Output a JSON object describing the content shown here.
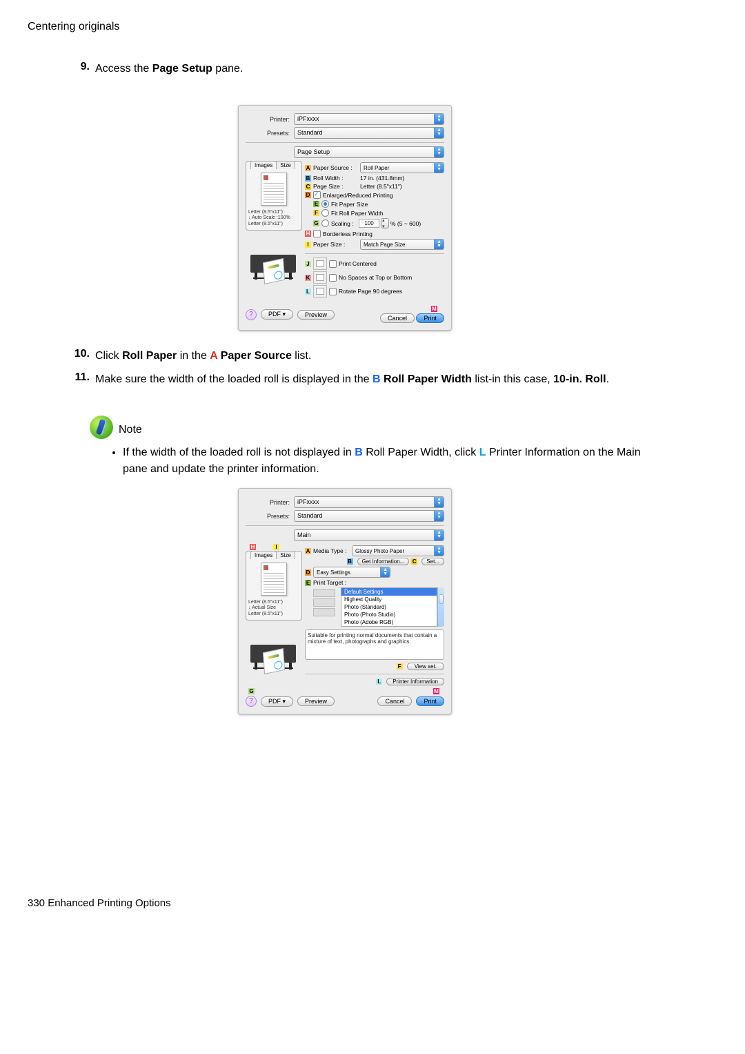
{
  "header": {
    "title": "Centering originals"
  },
  "steps": {
    "s9": {
      "num": "9.",
      "t1": "Access the ",
      "bold1": "Page Setup",
      "t2": " pane."
    },
    "s10": {
      "num": "10.",
      "t1": "Click ",
      "bold1": "Roll Paper",
      "t2": " in the ",
      "la": "A",
      "bold2": " Paper Source",
      "t3": " list."
    },
    "s11": {
      "num": "11.",
      "t1": "Make sure the width of the loaded roll is displayed in the ",
      "lb": "B",
      "bold1": " Roll Paper Width",
      "t2": " list-in this case, ",
      "bold2": "10-in.  Roll",
      "t3": "."
    }
  },
  "note": {
    "label": "Note",
    "line": {
      "t1": "If the width of the loaded roll is not displayed in ",
      "lb": "B",
      "bold1": " Roll Paper Width",
      "t2": ", click ",
      "ll": "L",
      "bold2": " Printer Information",
      "t3": " on the ",
      "bold3": "Main",
      "t4": " pane and update the printer information."
    }
  },
  "dlg1": {
    "printer_label": "Printer:",
    "printer_val": "iPFxxxx",
    "presets_label": "Presets:",
    "presets_val": "Standard",
    "pane_val": "Page Setup",
    "tabs": {
      "images": "Images",
      "size": "Size"
    },
    "prev_line1": "Letter (8.5\"x11\")",
    "prev_line2_arrow": "↓",
    "prev_line2": "Auto Scale :100%",
    "prev_line3": "Letter (8.5\"x11\")",
    "A": {
      "label": "Paper Source :",
      "val": "Roll Paper"
    },
    "B": {
      "label": "Roll Width :",
      "val": "17 in. (431.8mm)"
    },
    "C": {
      "label": "Page Size :",
      "val": "Letter (8.5\"x11\")"
    },
    "D": "Enlarged/Reduced Printing",
    "E": "Fit Paper Size",
    "F": "Fit Roll Paper Width",
    "G": {
      "label": "Scaling :",
      "val": "100",
      "suffix": "% (5 ~ 600)"
    },
    "H": "Borderless Printing",
    "I": {
      "label": "Paper Size :",
      "val": "Match Page Size"
    },
    "J": "Print Centered",
    "K": "No Spaces at Top or Bottom",
    "L": "Rotate Page 90 degrees",
    "help": "?",
    "pdf": "PDF ▾",
    "preview": "Preview",
    "cancel": "Cancel",
    "print": "Print",
    "Mtag": "M"
  },
  "dlg2": {
    "printer_label": "Printer:",
    "printer_val": "iPFxxxx",
    "presets_label": "Presets:",
    "presets_val": "Standard",
    "pane_val": "Main",
    "tabs": {
      "images": "Images",
      "size": "Size"
    },
    "Htag": "H",
    "Itag": "I",
    "prev_line1": "Letter (8.5\"x11\")",
    "prev_line2_arrow": "↓",
    "prev_line2": "Actual Size",
    "prev_line3": "Letter (8.5\"x11\")",
    "A": {
      "label": "Media Type :",
      "val": "Glossy Photo Paper"
    },
    "Btag": "B",
    "get_info": "Get Information...",
    "Ctag": "C",
    "set": "Set...",
    "D": "Easy Settings",
    "E": "Print Target :",
    "targets": [
      "Default Settings",
      "Highest Quality",
      "Photo (Standard)",
      "Photo (Photo Studio)",
      "Photo (Adobe RGB)"
    ],
    "desc": "Suitable for printing normal documents that contain a mixture of text, photographs and graphics.",
    "Ftag": "F",
    "view_set": "View set.",
    "Ltag": "L",
    "printer_info": "Printer Information",
    "Gtag": "G",
    "help": "?",
    "pdf": "PDF ▾",
    "preview": "Preview",
    "cancel": "Cancel",
    "print": "Print",
    "Mtag": "M"
  },
  "footer": {
    "page": "330",
    "section": "Enhanced Printing Options"
  }
}
